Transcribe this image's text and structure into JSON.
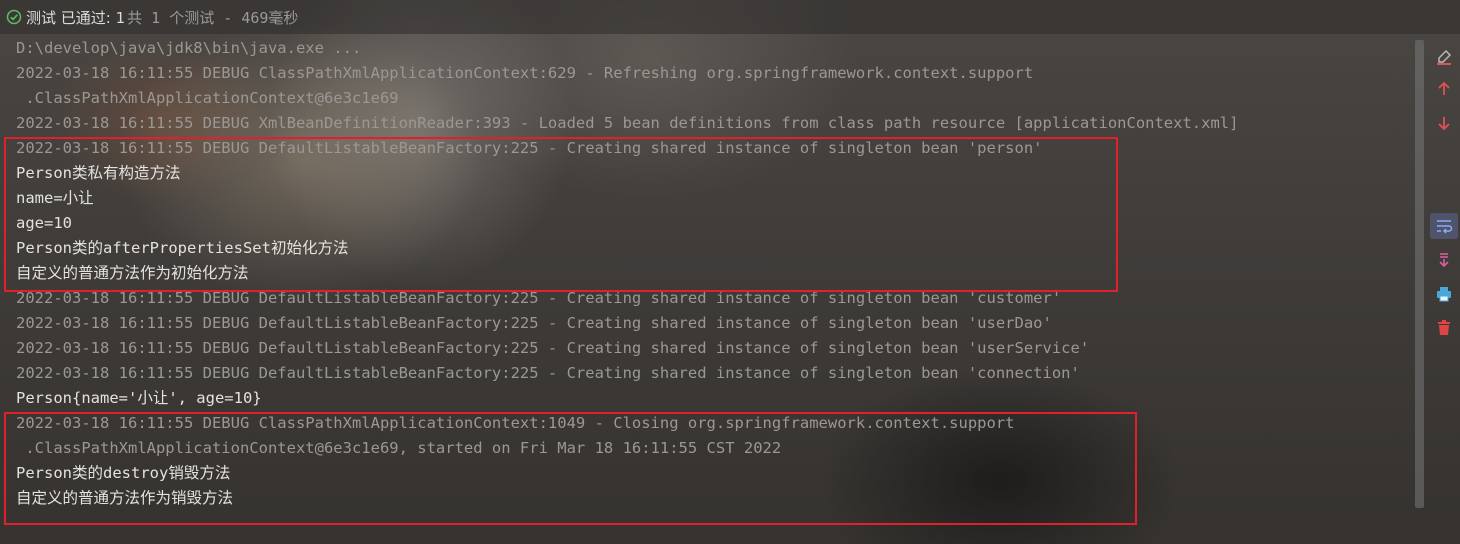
{
  "header": {
    "status_label": "测试 已通过: 1",
    "summary": "共 1 个测试 - 469毫秒"
  },
  "console": {
    "lines": [
      {
        "text": "D:\\develop\\java\\jdk8\\bin\\java.exe ...",
        "kind": "log"
      },
      {
        "text": "2022-03-18 16:11:55 DEBUG ClassPathXmlApplicationContext:629 - Refreshing org.springframework.context.support",
        "kind": "log"
      },
      {
        "text": " .ClassPathXmlApplicationContext@6e3c1e69",
        "kind": "log"
      },
      {
        "text": "2022-03-18 16:11:55 DEBUG XmlBeanDefinitionReader:393 - Loaded 5 bean definitions from class path resource [applicationContext.xml]",
        "kind": "log"
      },
      {
        "text": "2022-03-18 16:11:55 DEBUG DefaultListableBeanFactory:225 - Creating shared instance of singleton bean 'person'",
        "kind": "log"
      },
      {
        "text": "Person类私有构造方法",
        "kind": "out"
      },
      {
        "text": "name=小让",
        "kind": "out"
      },
      {
        "text": "age=10",
        "kind": "out"
      },
      {
        "text": "Person类的afterPropertiesSet初始化方法",
        "kind": "out"
      },
      {
        "text": "自定义的普通方法作为初始化方法",
        "kind": "out"
      },
      {
        "text": "2022-03-18 16:11:55 DEBUG DefaultListableBeanFactory:225 - Creating shared instance of singleton bean 'customer'",
        "kind": "log"
      },
      {
        "text": "2022-03-18 16:11:55 DEBUG DefaultListableBeanFactory:225 - Creating shared instance of singleton bean 'userDao'",
        "kind": "log"
      },
      {
        "text": "2022-03-18 16:11:55 DEBUG DefaultListableBeanFactory:225 - Creating shared instance of singleton bean 'userService'",
        "kind": "log"
      },
      {
        "text": "2022-03-18 16:11:55 DEBUG DefaultListableBeanFactory:225 - Creating shared instance of singleton bean 'connection'",
        "kind": "log"
      },
      {
        "text": "Person{name='小让', age=10}",
        "kind": "out"
      },
      {
        "text": "2022-03-18 16:11:55 DEBUG ClassPathXmlApplicationContext:1049 - Closing org.springframework.context.support",
        "kind": "log"
      },
      {
        "text": " .ClassPathXmlApplicationContext@6e3c1e69, started on Fri Mar 18 16:11:55 CST 2022",
        "kind": "log"
      },
      {
        "text": "Person类的destroy销毁方法",
        "kind": "out"
      },
      {
        "text": "自定义的普通方法作为销毁方法",
        "kind": "out"
      }
    ]
  },
  "toolbar": {
    "icons": [
      "clear-all-icon",
      "scroll-up-icon",
      "scroll-down-icon",
      "soft-wrap-icon",
      "scroll-to-end-icon",
      "print-icon",
      "trash-icon"
    ]
  },
  "colors": {
    "pass": "#5fb85f",
    "highlight": "#e0202a",
    "tool_red": "#e05252",
    "tool_blue": "#4aa8d8"
  }
}
